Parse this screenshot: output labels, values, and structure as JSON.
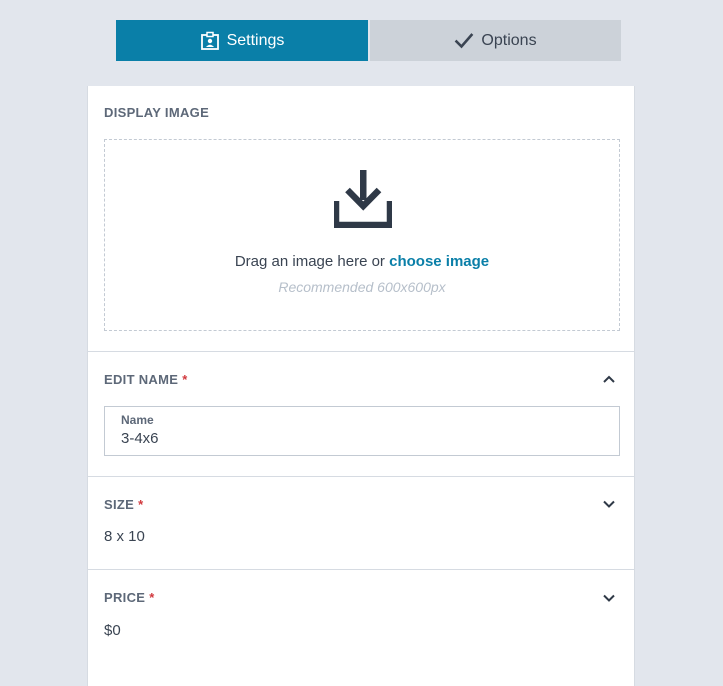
{
  "tabs": {
    "settings_label": "Settings",
    "options_label": "Options",
    "settings_icon": "id-badge-icon",
    "options_icon": "checkmark-icon"
  },
  "display_image": {
    "title": "DISPLAY IMAGE",
    "drag_text": "Drag an image here or",
    "choose_link": "choose image",
    "recommended": "Recommended 600x600px",
    "icon": "download-icon"
  },
  "edit_name": {
    "title": "EDIT NAME",
    "required_mark": "*",
    "field_label": "Name",
    "field_value": "3-4x6",
    "toggle_icon": "chevron-up-icon"
  },
  "size": {
    "title": "SIZE",
    "required_mark": "*",
    "value": "8 x 10",
    "toggle_icon": "chevron-down-icon"
  },
  "price": {
    "title": "PRICE",
    "required_mark": "*",
    "value": "$0",
    "toggle_icon": "chevron-down-icon"
  },
  "colors": {
    "accent": "#0a7fa8",
    "required": "#d1383d",
    "background": "#e2e6ed"
  }
}
